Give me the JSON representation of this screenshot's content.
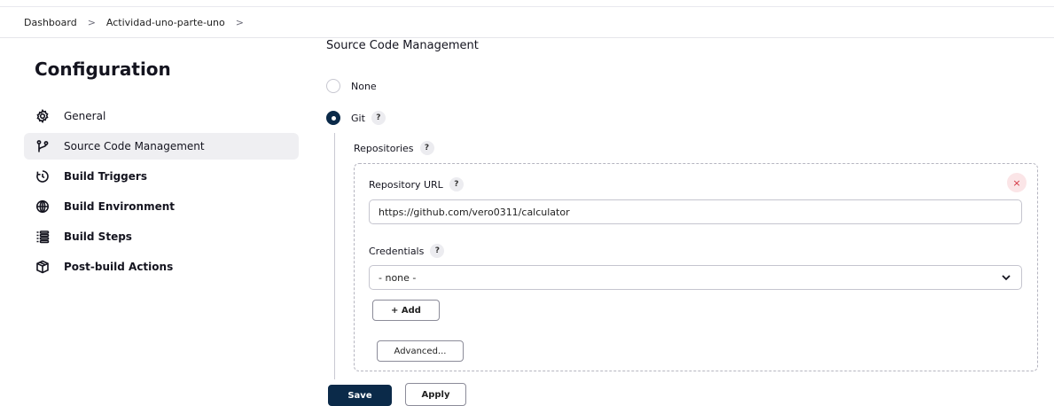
{
  "breadcrumb": {
    "items": [
      "Dashboard",
      "Actividad-uno-parte-uno"
    ],
    "separator": ">"
  },
  "page": {
    "title": "Configuration"
  },
  "sidebar": {
    "items": [
      {
        "label": "General",
        "icon": "gear-icon",
        "active": false
      },
      {
        "label": "Source Code Management",
        "icon": "git-branch-icon",
        "active": true
      },
      {
        "label": "Build Triggers",
        "icon": "timer-icon",
        "active": false
      },
      {
        "label": "Build Environment",
        "icon": "globe-icon",
        "active": false
      },
      {
        "label": "Build Steps",
        "icon": "list-icon",
        "active": false
      },
      {
        "label": "Post-build Actions",
        "icon": "package-icon",
        "active": false
      }
    ]
  },
  "scm": {
    "title": "Source Code Management",
    "options": [
      {
        "label": "None",
        "selected": false
      },
      {
        "label": "Git",
        "selected": true
      }
    ],
    "repositories_label": "Repositories",
    "help_glyph": "?",
    "repository": {
      "url_label": "Repository URL",
      "url_value": "https://github.com/vero0311/calculator",
      "delete_glyph": "×",
      "credentials_label": "Credentials",
      "credentials_value": "- none -",
      "add_label": "+ Add",
      "advanced_label": "Advanced..."
    }
  },
  "footer": {
    "save_label": "Save",
    "apply_label": "Apply"
  },
  "colors": {
    "primary": "#0b2a49",
    "danger": "#d3323f",
    "active_bg": "#efeff2"
  }
}
